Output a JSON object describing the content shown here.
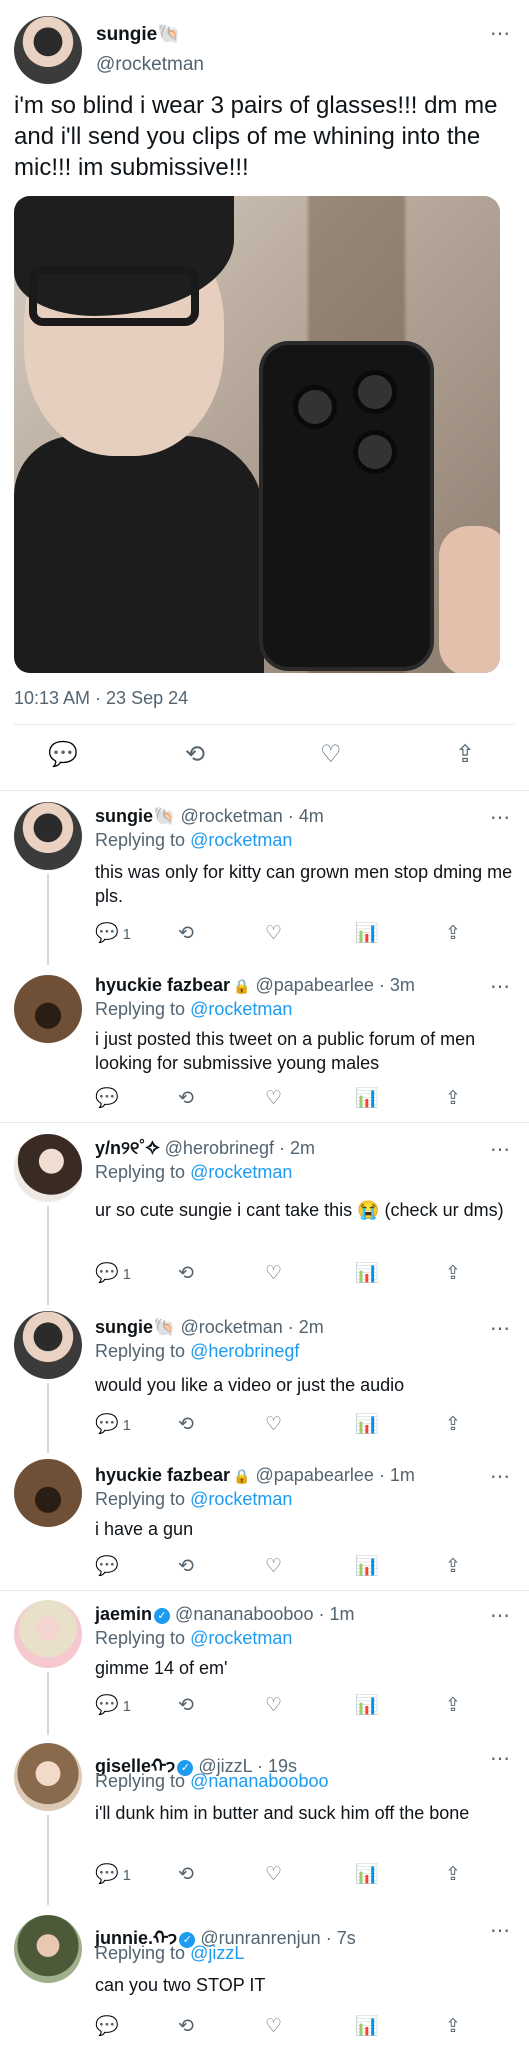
{
  "colors": {
    "accent": "#1d9bf0",
    "muted": "#536471",
    "text": "#0f1419",
    "divider": "#e6e9ec"
  },
  "main_tweet": {
    "author_name": "sungie🐚",
    "author_handle": "@rocketman",
    "more_icon": "⋯",
    "text": "i'm so blind i wear 3 pairs of glasses!!! dm me and i'll send you clips of me whining into the mic!!! im submissive!!!",
    "timestamp": "10:13 AM · 23 Sep 24",
    "actions": {
      "reply_icon": "💬",
      "retweet_icon": "⟲",
      "like_icon": "♡",
      "share_icon": "⇪"
    }
  },
  "replies": [
    {
      "name": "sungie🐚",
      "handle": "@rocketman",
      "time": "· 4m",
      "replying_prefix": "Replying to",
      "replying_to": "@rocketman",
      "text": "this was only for kitty can grown men stop dming me pls.",
      "reply_count": "1",
      "verified": false,
      "locked": false
    },
    {
      "name": "hyuckie fazbear",
      "handle": "@papabearlee",
      "time": "· 3m",
      "replying_prefix": "Replying to",
      "replying_to": "@rocketman",
      "text": "i just posted this tweet on a public forum of men looking for submissive young males",
      "reply_count": "",
      "verified": false,
      "locked": true
    },
    {
      "name": "y/n୨୧˚✧",
      "handle": "@herobrinegf",
      "time": "· 2m",
      "replying_prefix": "Replying to",
      "replying_to": "@rocketman",
      "text": "ur so cute sungie i cant take this 😭  (check ur dms)",
      "reply_count": "1",
      "verified": false,
      "locked": false
    },
    {
      "name": "sungie🐚",
      "handle": "@rocketman",
      "time": "· 2m",
      "replying_prefix": "Replying to",
      "replying_to": "@herobrinegf",
      "text": "would you like a video or just the audio",
      "reply_count": "1",
      "verified": false,
      "locked": false
    },
    {
      "name": "hyuckie fazbear",
      "handle": "@papabearlee",
      "time": "· 1m",
      "replying_prefix": "Replying to",
      "replying_to": "@rocketman",
      "text": "i have a gun",
      "reply_count": "",
      "verified": false,
      "locked": true
    },
    {
      "name": "jaemin",
      "handle": "@nananabooboo",
      "time": "· 1m",
      "replying_prefix": "Replying to",
      "replying_to": "@rocketman",
      "text": "gimme 14 of em'",
      "reply_count": "1",
      "verified": true,
      "locked": false
    },
    {
      "name": "giselleᡣ𐭩",
      "handle": "@jizzL",
      "time": "· 19s",
      "replying_prefix": "Replying to",
      "replying_to": "@nananabooboo",
      "text": "i'll dunk him in butter and suck him off the bone",
      "reply_count": "1",
      "verified": true,
      "locked": false
    },
    {
      "name": "junnie.ᡣ𐭩",
      "handle": "@runranrenjun",
      "time": "· 7s",
      "replying_prefix": "Replying to",
      "replying_to": "@jizzL",
      "text": "can you two STOP IT",
      "reply_count": "",
      "verified": true,
      "locked": false
    }
  ],
  "reply_action_icons": {
    "reply": "💬",
    "retweet": "⟲",
    "like": "♡",
    "views": "📊",
    "share": "⇪"
  }
}
